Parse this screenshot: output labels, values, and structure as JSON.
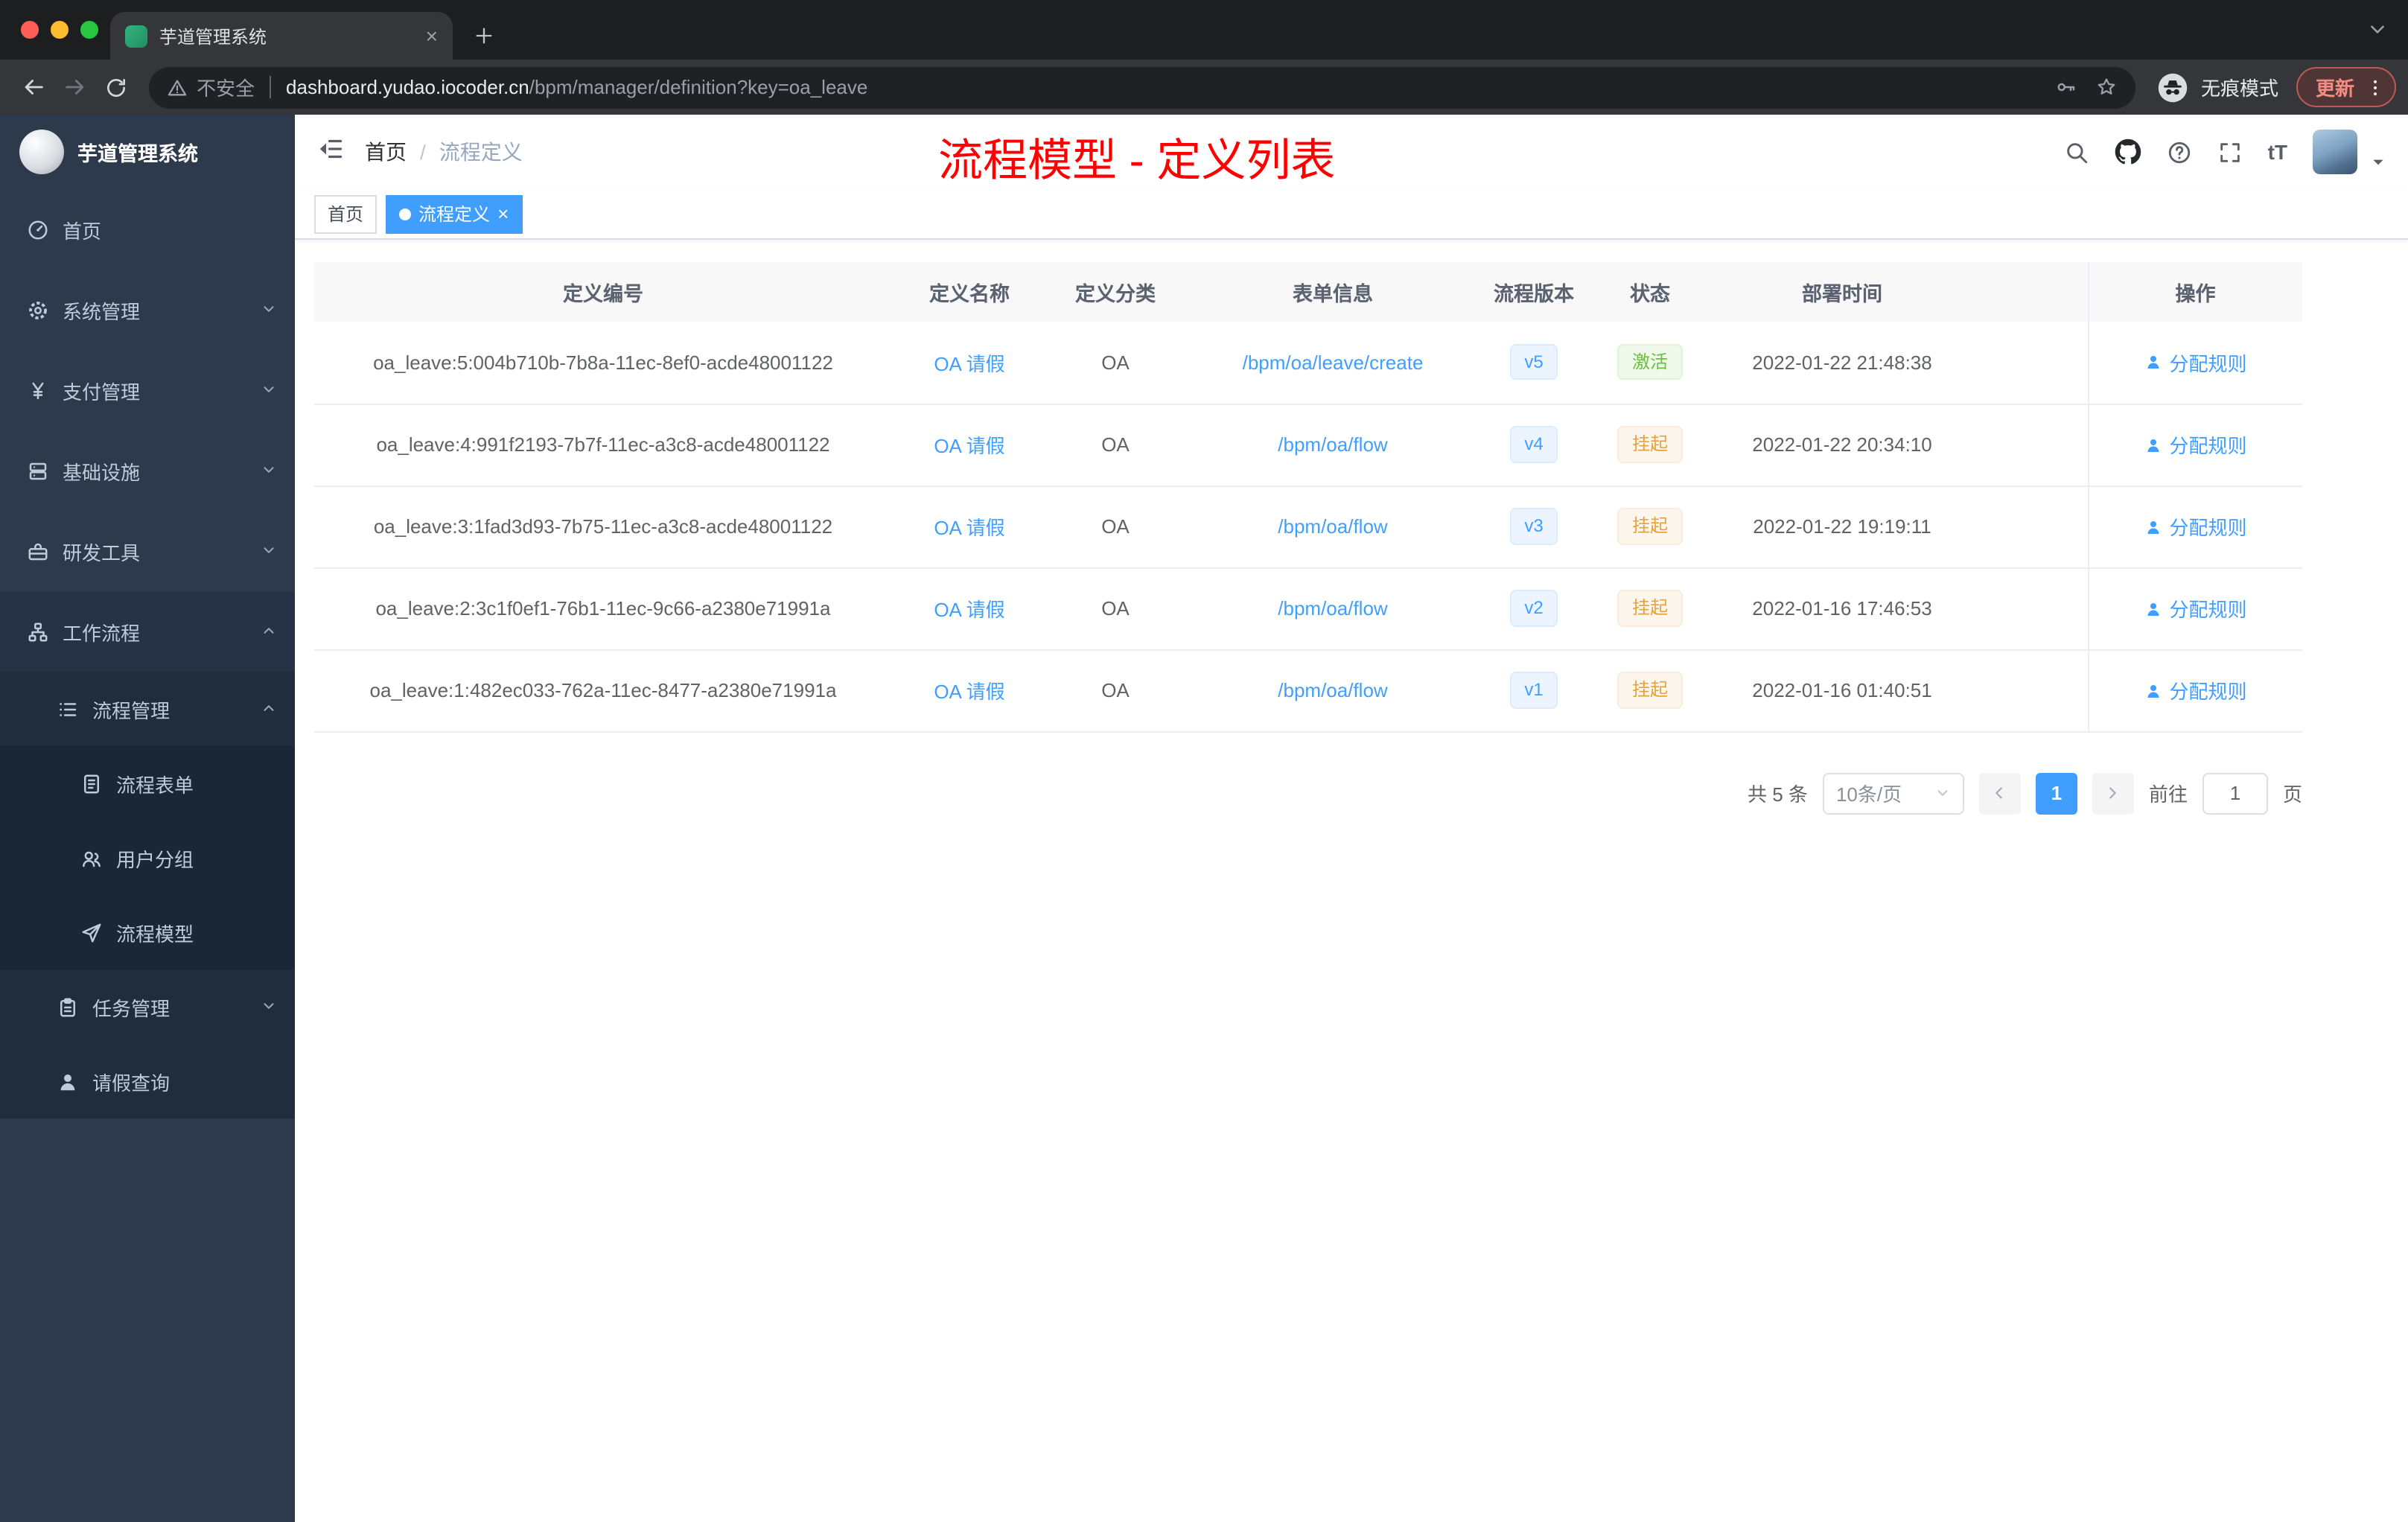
{
  "colors": {
    "primary": "#409EFF",
    "success": "#67C23A",
    "warning": "#E6A23C",
    "annotation_red": "#FF0000",
    "sidebar_bg": "#2D3A4B",
    "table_header_bg": "#F8F8F9"
  },
  "browser": {
    "tab_title": "芋道管理系统",
    "security_label": "不安全",
    "url_domain": "dashboard.yudao.iocoder.cn",
    "url_path": "/bpm/manager/definition?key=oa_leave",
    "incognito_label": "无痕模式",
    "update_label": "更新"
  },
  "header": {
    "breadcrumb_home": "首页",
    "breadcrumb_sep": "/",
    "breadcrumb_current": "流程定义",
    "overlay_title": "流程模型 - 定义列表"
  },
  "sidebar": {
    "app_title": "芋道管理系统",
    "items": [
      {
        "label": "首页"
      },
      {
        "label": "系统管理"
      },
      {
        "label": "支付管理"
      },
      {
        "label": "基础设施"
      },
      {
        "label": "研发工具"
      },
      {
        "label": "工作流程"
      },
      {
        "label": "流程管理"
      },
      {
        "label": "流程表单"
      },
      {
        "label": "用户分组"
      },
      {
        "label": "流程模型"
      },
      {
        "label": "任务管理"
      },
      {
        "label": "请假查询"
      }
    ]
  },
  "tags": [
    {
      "label": "首页"
    },
    {
      "label": "流程定义"
    }
  ],
  "table": {
    "columns": [
      "定义编号",
      "定义名称",
      "定义分类",
      "表单信息",
      "流程版本",
      "状态",
      "部署时间",
      "操作"
    ],
    "rows": [
      {
        "id": "oa_leave:5:004b710b-7b8a-11ec-8ef0-acde48001122",
        "name": "OA 请假",
        "category": "OA",
        "form": "/bpm/oa/leave/create",
        "version": "v5",
        "status": "激活",
        "time": "2022-01-22 21:48:38",
        "action": "分配规则"
      },
      {
        "id": "oa_leave:4:991f2193-7b7f-11ec-a3c8-acde48001122",
        "name": "OA 请假",
        "category": "OA",
        "form": "/bpm/oa/flow",
        "version": "v4",
        "status": "挂起",
        "time": "2022-01-22 20:34:10",
        "action": "分配规则"
      },
      {
        "id": "oa_leave:3:1fad3d93-7b75-11ec-a3c8-acde48001122",
        "name": "OA 请假",
        "category": "OA",
        "form": "/bpm/oa/flow",
        "version": "v3",
        "status": "挂起",
        "time": "2022-01-22 19:19:11",
        "action": "分配规则"
      },
      {
        "id": "oa_leave:2:3c1f0ef1-76b1-11ec-9c66-a2380e71991a",
        "name": "OA 请假",
        "category": "OA",
        "form": "/bpm/oa/flow",
        "version": "v2",
        "status": "挂起",
        "time": "2022-01-16 17:46:53",
        "action": "分配规则"
      },
      {
        "id": "oa_leave:1:482ec033-762a-11ec-8477-a2380e71991a",
        "name": "OA 请假",
        "category": "OA",
        "form": "/bpm/oa/flow",
        "version": "v1",
        "status": "挂起",
        "time": "2022-01-16 01:40:51",
        "action": "分配规则"
      }
    ]
  },
  "pagination": {
    "total": "共 5 条",
    "page_size": "10条/页",
    "current_page": "1",
    "goto_label": "前往",
    "goto_value": "1",
    "goto_unit": "页"
  }
}
